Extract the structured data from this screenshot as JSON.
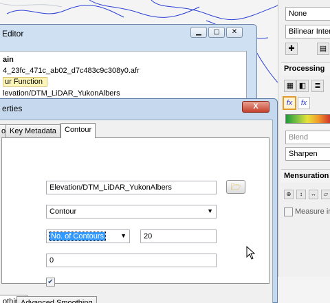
{
  "editor_window": {
    "title": "Editor",
    "tree": [
      "ain",
      "4_23fc_471c_ab02_d7c483c9c308y0.afr",
      "ur Function",
      "levation/DTM_LiDAR_YukonAlbers"
    ]
  },
  "properties_dialog": {
    "title": "erties",
    "close_glyph": "X",
    "tabs": [
      "o",
      "Key Metadata",
      "Contour"
    ],
    "active_tab": "Contour",
    "input_raster": "Elevation/DTM_LiDAR_YukonAlbers",
    "function_type": "Contour",
    "method": "No. of Contours",
    "count": "20",
    "base": "0",
    "checkbox_checked": true,
    "sub_tabs": [
      "othing",
      "Advanced Smoothing"
    ],
    "active_sub_tab": "othing"
  },
  "right_panel": {
    "resampling_top": "None",
    "resampling": "Bilinear Interp",
    "processing_header": "Processing",
    "blend": "Blend",
    "sharpen": "Sharpen",
    "mensuration_header": "Mensuration",
    "measure_label": "Measure in"
  },
  "icons": {
    "function_editor_active": "fx-icon",
    "function_editor_alt": "fx-italic-icon",
    "folder": "folder-open-icon"
  },
  "colors": {
    "contour_lines": "#2a3fd6",
    "title_bar": "#c5d8ee",
    "close_button": "#c6412c",
    "selection_highlight": "#3399ff",
    "tree_highlight": "#fef5b8"
  }
}
